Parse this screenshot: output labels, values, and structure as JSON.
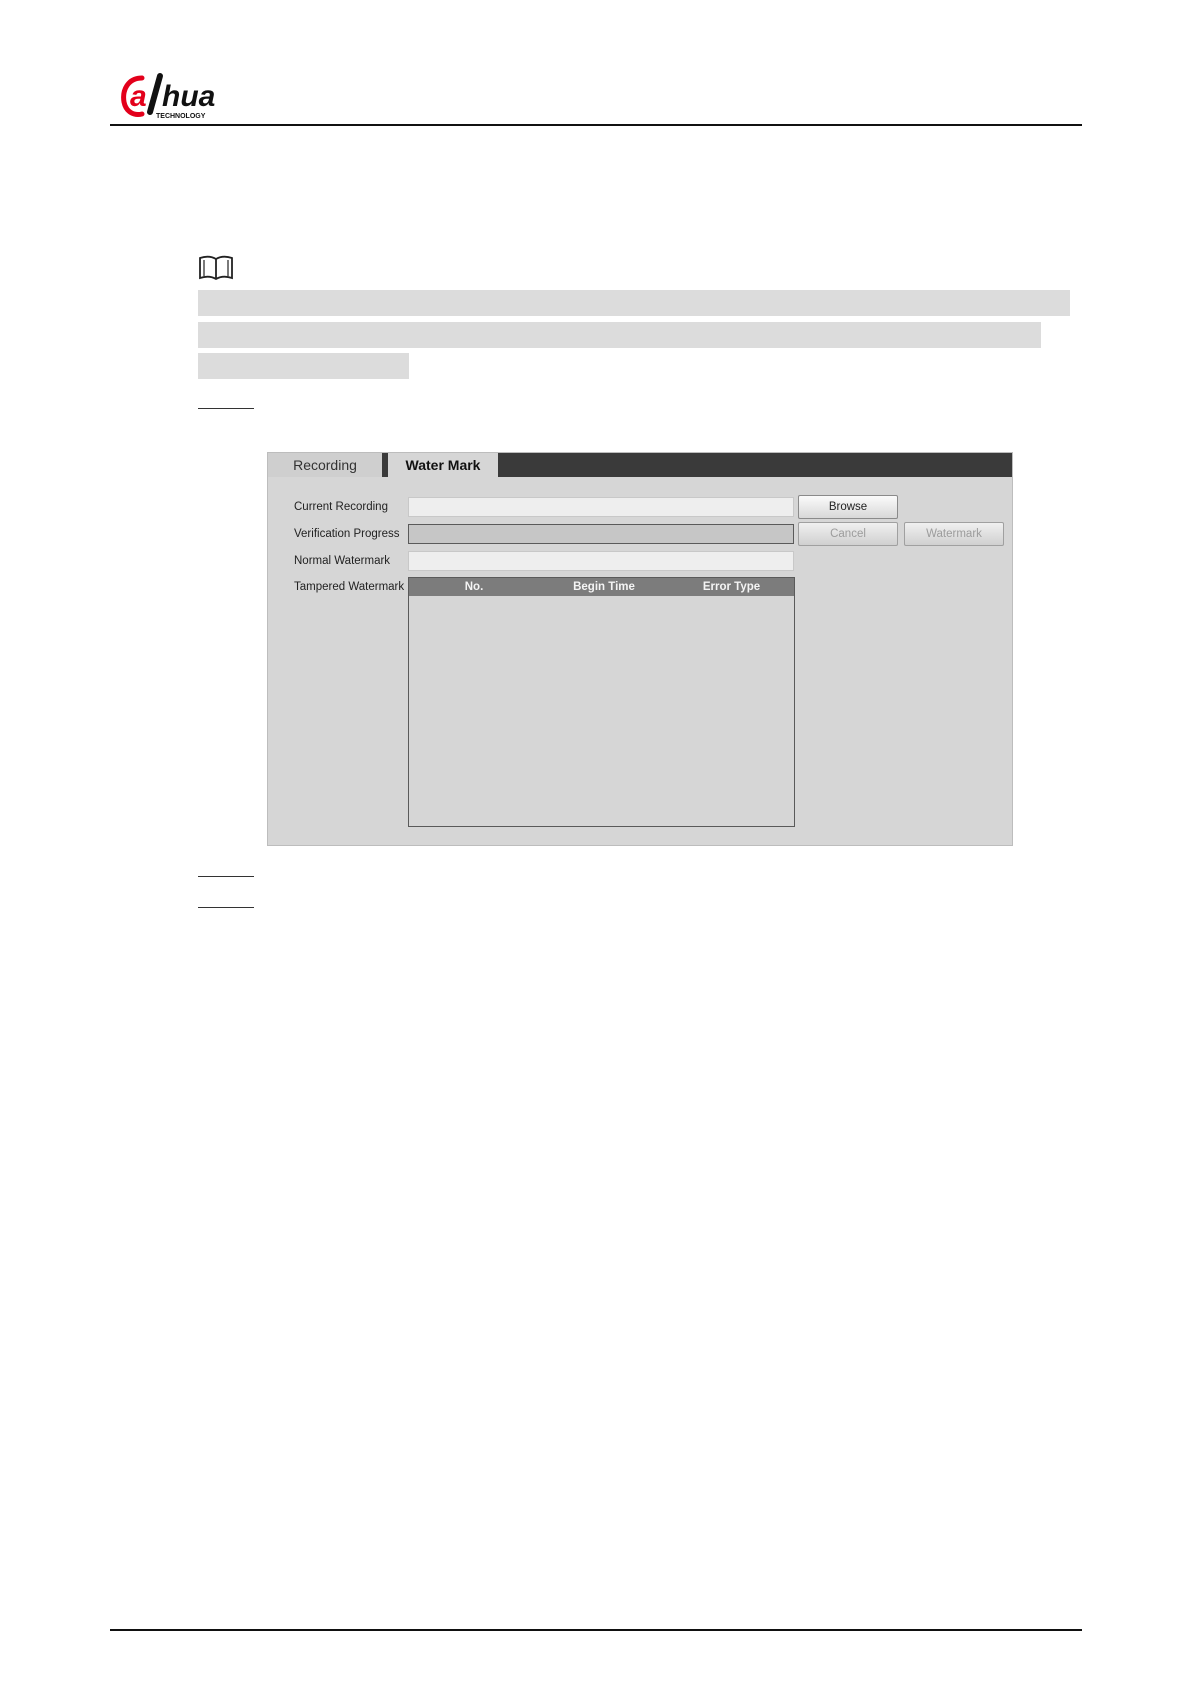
{
  "header": {
    "logo_text": "alhua",
    "logo_subtext": "TECHNOLOGY"
  },
  "panel": {
    "tabs": [
      {
        "label": "Recording",
        "active": false
      },
      {
        "label": "Water Mark",
        "active": true
      }
    ],
    "fields": {
      "current_recording_label": "Current Recording",
      "verification_progress_label": "Verification Progress",
      "normal_watermark_label": "Normal Watermark",
      "tampered_watermark_label": "Tampered Watermark",
      "current_recording_value": "",
      "normal_watermark_value": ""
    },
    "buttons": {
      "browse": "Browse",
      "cancel": "Cancel",
      "watermark": "Watermark"
    },
    "table": {
      "columns": [
        "No.",
        "Begin Time",
        "Error Type"
      ],
      "rows": []
    }
  },
  "colors": {
    "brand_red": "#e3001b",
    "tab_bar_dark": "#3a3a3a",
    "panel_gray": "#d6d6d6",
    "table_header": "#7c7c7c"
  },
  "icons": {
    "note": "book-note-icon"
  }
}
